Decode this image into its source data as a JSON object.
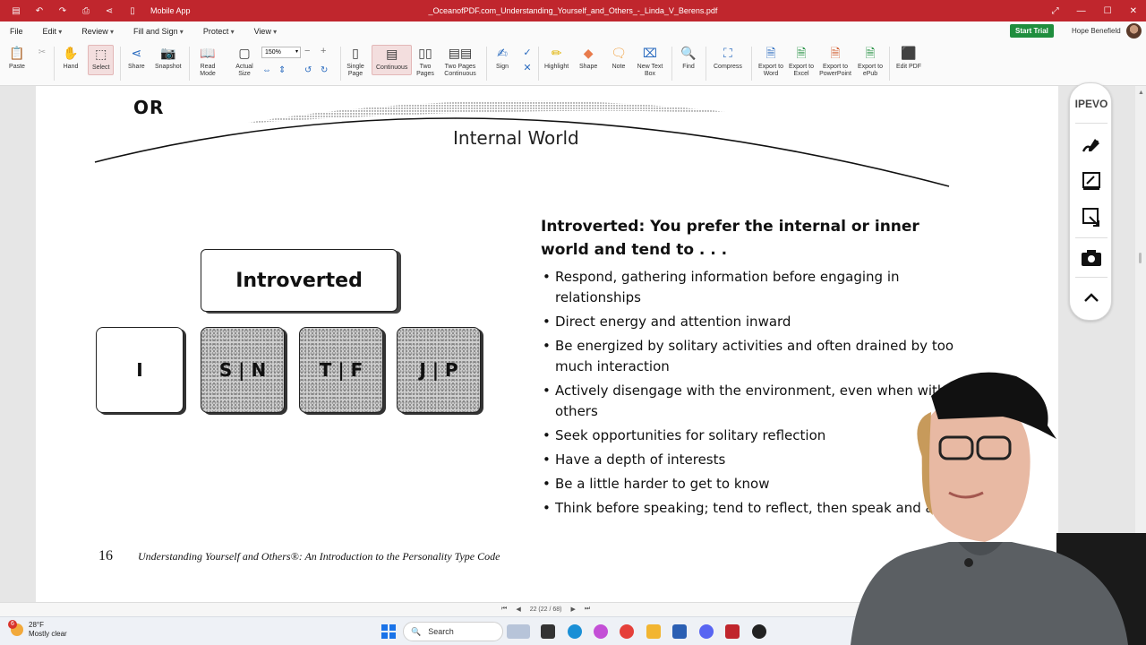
{
  "titlebar": {
    "app_name": "Mobile App",
    "file_title": "_OceanofPDF.com_Understanding_Yourself_and_Others_-_Linda_V_Berens.pdf",
    "color": "#c0262d"
  },
  "menubar": {
    "items": [
      "File",
      "Edit",
      "Review",
      "Fill and Sign",
      "Protect",
      "View"
    ],
    "trial_button": "Start Trial",
    "user_name": "Hope Benefield"
  },
  "toolbar": {
    "paste": "Paste",
    "hand": "Hand",
    "select": "Select",
    "share": "Share",
    "snapshot": "Snapshot",
    "read_mode": "Read Mode",
    "actual_size": "Actual Size",
    "zoom": "150%",
    "single_page": "Single Page",
    "continuous": "Continuous",
    "two_pages": "Two Pages",
    "two_pages_continuous": "Two Pages Continuous",
    "sign": "Sign",
    "highlight": "Highlight",
    "shape": "Shape",
    "note": "Note",
    "new_text_box": "New Text Box",
    "find": "Find",
    "compress": "Compress",
    "export_word": "Export to Word",
    "export_excel": "Export to Excel",
    "export_ppt": "Export to PowerPoint",
    "export_epub": "Export to ePub",
    "edit_pdf": "Edit PDF"
  },
  "document": {
    "or_label": "OR",
    "internal_world": "Internal World",
    "introverted_box": "Introverted",
    "letters": [
      "I",
      "S | N",
      "T | F",
      "J | P"
    ],
    "heading": "Introverted: You prefer the internal or inner world and tend to . . .",
    "bullets": [
      "Respond, gathering information before engaging in relationships",
      "Direct energy and attention inward",
      "Be energized by solitary activities and often drained by too much interaction",
      "Actively disengage with the environment, even when with others",
      "Seek opportunities for solitary reflection",
      "Have a depth of interests",
      "Be a little harder to get to know",
      "Think before speaking; tend to reflect, then speak and act"
    ],
    "page_number": "16",
    "book_title": "Understanding Yourself and Others®: An Introduction to the Personality Type Code"
  },
  "ipevo": {
    "label": "IPEVO"
  },
  "statusbar": {
    "page_indicator": "22 (22 / 68)"
  },
  "taskbar": {
    "temperature": "28°F",
    "weather": "Mostly clear",
    "weather_badge": "6",
    "search_placeholder": "Search"
  }
}
